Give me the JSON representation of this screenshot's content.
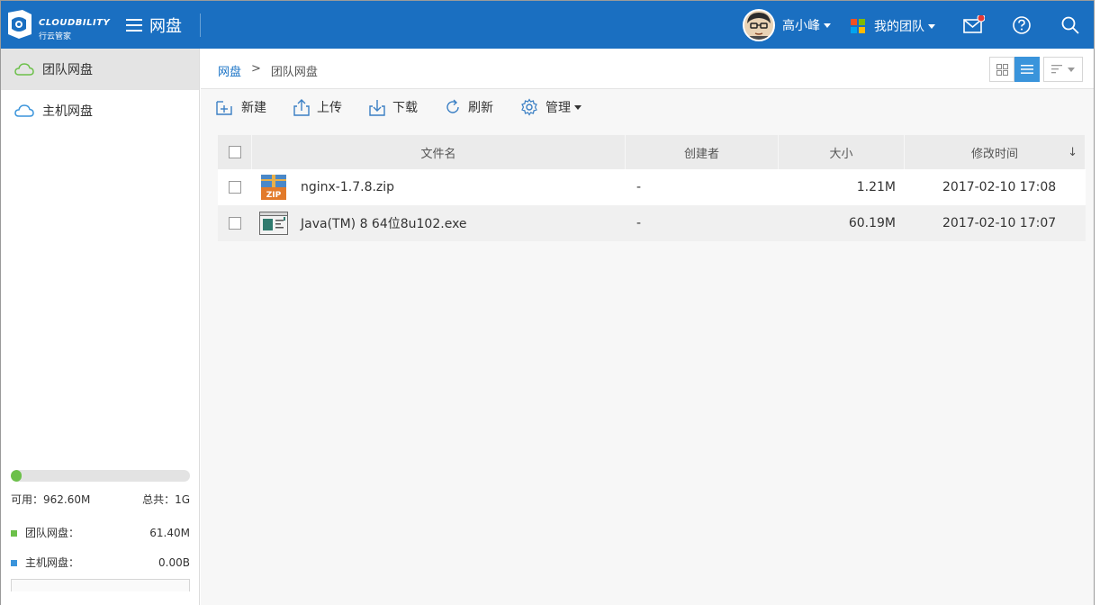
{
  "header": {
    "logo_text": "CLOUDBILITY",
    "logo_sub": "行云管家",
    "app_title": "网盘",
    "user_name": "高小峰",
    "team_label": "我的团队",
    "colors": {
      "bar": "#1a6fc1",
      "notify_dot": "#e53935"
    }
  },
  "sidebar": {
    "items": [
      {
        "label": "团队网盘",
        "icon": "cloud-icon",
        "active": true
      },
      {
        "label": "主机网盘",
        "icon": "cloud-icon",
        "active": false
      }
    ],
    "storage": {
      "used_fraction": 0.06,
      "available_label": "可用：962.60M",
      "total_label": "总共：1G",
      "team_label": "团队网盘：",
      "team_value": "61.40M",
      "host_label": "主机网盘：",
      "host_value": "0.00B",
      "colors": {
        "team": "#6cc04a",
        "host": "#3a94db"
      }
    }
  },
  "breadcrumb": {
    "root": "网盘",
    "separator": ">",
    "current": "团队网盘"
  },
  "toolbar": {
    "new_label": "新建",
    "upload_label": "上传",
    "download_label": "下载",
    "refresh_label": "刷新",
    "manage_label": "管理"
  },
  "table": {
    "columns": {
      "name": "文件名",
      "creator": "创建者",
      "size": "大小",
      "modified": "修改时间",
      "sort_indicator": "↓"
    },
    "rows": [
      {
        "name": "nginx-1.7.8.zip",
        "icon": "zip-file-icon",
        "icon_text": "ZIP",
        "creator": "-",
        "size": "1.21M",
        "modified": "2017-02-10 17:08"
      },
      {
        "name": "Java(TM) 8 64位8u102.exe",
        "icon": "exe-file-icon",
        "creator": "-",
        "size": "60.19M",
        "modified": "2017-02-10 17:07"
      }
    ]
  }
}
